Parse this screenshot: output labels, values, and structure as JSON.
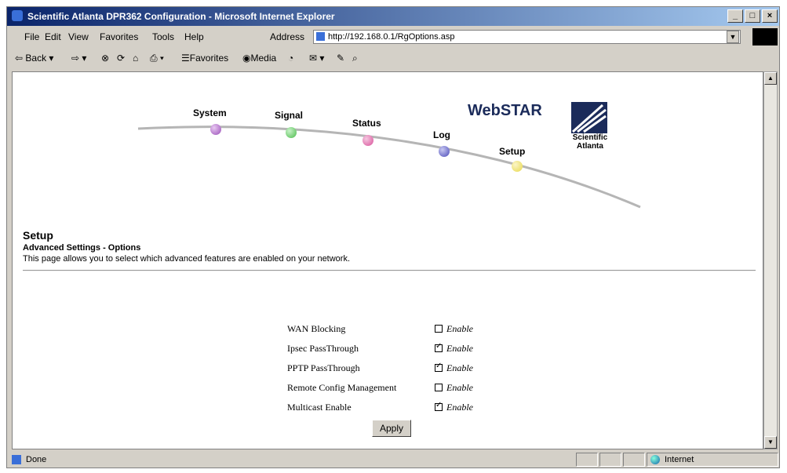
{
  "window": {
    "title": "Scientific Atlanta DPR362 Configuration - Microsoft Internet Explorer"
  },
  "menu": {
    "items": [
      "File",
      "Edit",
      "View",
      "Favorites",
      "Tools",
      "Help"
    ]
  },
  "address": {
    "label": "Address",
    "url": "http://192.168.0.1/RgOptions.asp"
  },
  "toolbar": {
    "back": "Back",
    "favorites": "Favorites",
    "media": "Media"
  },
  "nav": {
    "system": "System",
    "signal": "Signal",
    "status": "Status",
    "log": "Log",
    "setup": "Setup"
  },
  "logos": {
    "webstar": "WebSTAR",
    "sa_line1": "Scientific",
    "sa_line2": "Atlanta"
  },
  "page": {
    "heading": "Setup",
    "subheading": "Advanced Settings - Options",
    "description": "This page allows you to select which advanced features are enabled on your network."
  },
  "options": [
    {
      "label": "WAN Blocking",
      "checked": false,
      "enable_text": "Enable"
    },
    {
      "label": "Ipsec PassThrough",
      "checked": true,
      "enable_text": "Enable"
    },
    {
      "label": "PPTP PassThrough",
      "checked": true,
      "enable_text": "Enable"
    },
    {
      "label": "Remote Config Management",
      "checked": false,
      "enable_text": "Enable"
    },
    {
      "label": "Multicast Enable",
      "checked": true,
      "enable_text": "Enable"
    }
  ],
  "apply_label": "Apply",
  "statusbar": {
    "left": "Done",
    "zone": "Internet"
  },
  "colors": {
    "system_dot": "#9a4fb8",
    "signal_dot": "#4cbb4c",
    "status_dot": "#d8509a",
    "log_dot": "#4a4ab8",
    "setup_dot": "#e8d84a"
  }
}
